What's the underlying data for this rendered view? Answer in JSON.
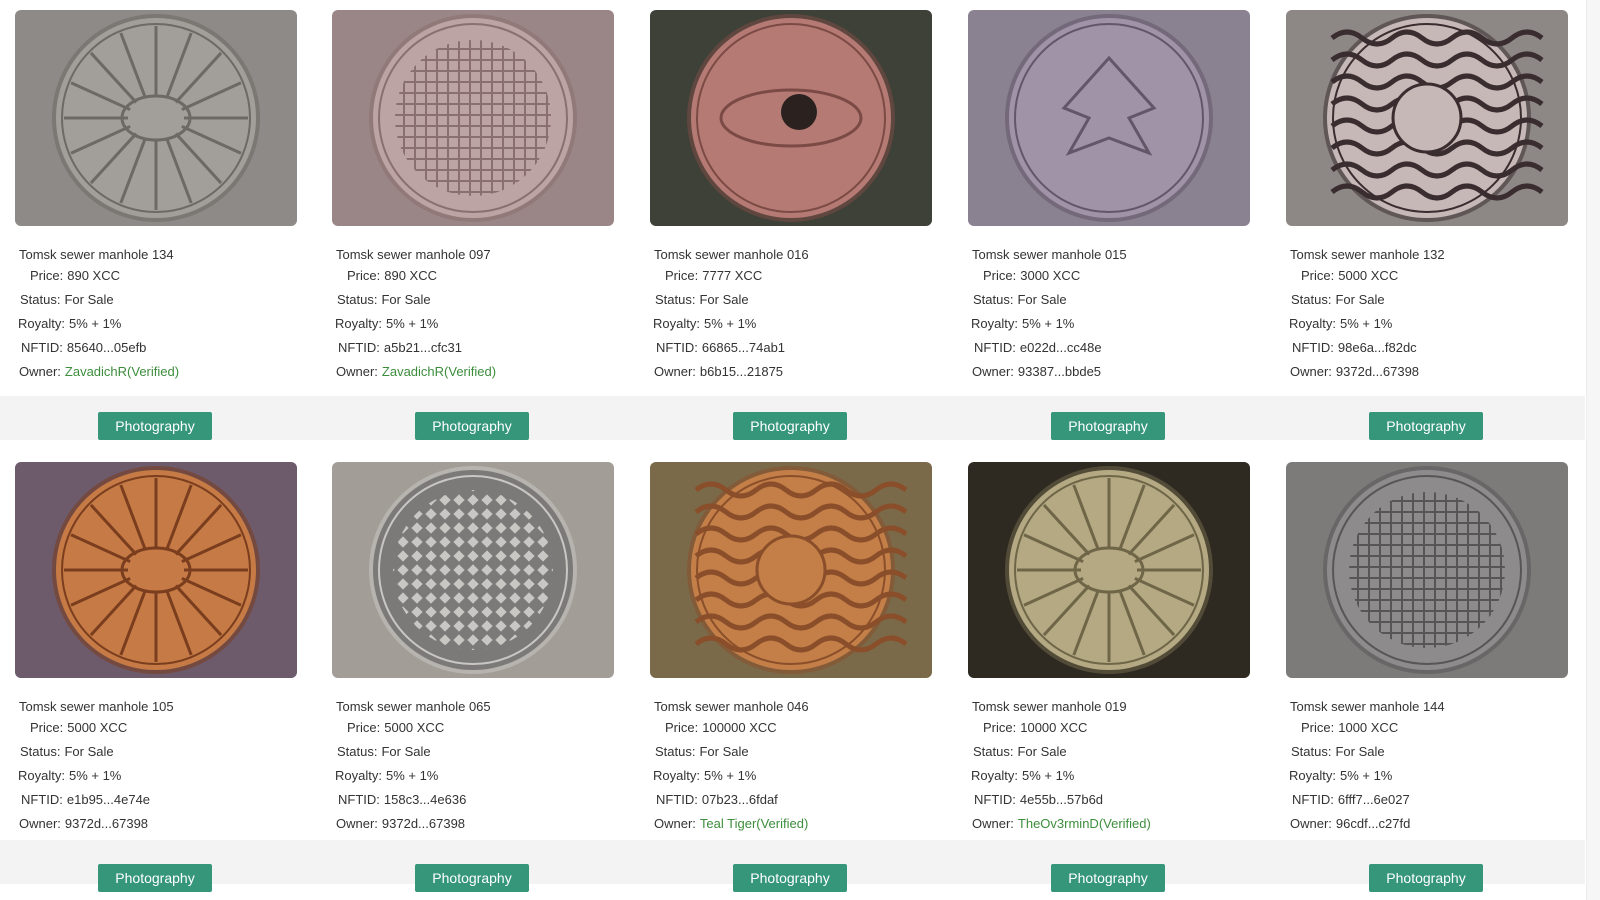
{
  "labels": {
    "price": "Price:",
    "status": "Status:",
    "royalty": "Royalty:",
    "nftid": "NFTID:",
    "owner": "Owner:"
  },
  "colors": {
    "tag_bg": "#35967a",
    "verified_owner": "#3c8d3c"
  },
  "items": [
    {
      "name": "Tomsk sewer manhole 134",
      "price": "890 XCC",
      "status": "For Sale",
      "royalty": "5% + 1%",
      "nftid": "85640...05efb",
      "owner": "ZavadichR(Verified)",
      "owner_verified": true,
      "tag": "Photography",
      "image": "spoked-manhole-grey"
    },
    {
      "name": "Tomsk sewer manhole 097",
      "price": "890 XCC",
      "status": "For Sale",
      "royalty": "5% + 1%",
      "nftid": "a5b21...cfc31",
      "owner": "ZavadichR(Verified)",
      "owner_verified": true,
      "tag": "Photography",
      "image": "grid-manhole-pink"
    },
    {
      "name": "Tomsk sewer manhole 016",
      "price": "7777 XCC",
      "status": "For Sale",
      "royalty": "5% + 1%",
      "nftid": "66865...74ab1",
      "owner": "b6b15...21875",
      "owner_verified": false,
      "tag": "Photography",
      "image": "eye-manhole-red"
    },
    {
      "name": "Tomsk sewer manhole 015",
      "price": "3000 XCC",
      "status": "For Sale",
      "royalty": "5% + 1%",
      "nftid": "e022d...cc48e",
      "owner": "93387...bbde5",
      "owner_verified": false,
      "tag": "Photography",
      "image": "leaf-manhole-purple"
    },
    {
      "name": "Tomsk sewer manhole 132",
      "price": "5000 XCC",
      "status": "For Sale",
      "royalty": "5% + 1%",
      "nftid": "98e6a...f82dc",
      "owner": "9372d...67398",
      "owner_verified": false,
      "tag": "Photography",
      "image": "wave-manhole-ks"
    },
    {
      "name": "Tomsk sewer manhole 105",
      "price": "5000 XCC",
      "status": "For Sale",
      "royalty": "5% + 1%",
      "nftid": "e1b95...4e74e",
      "owner": "9372d...67398",
      "owner_verified": false,
      "tag": "Photography",
      "image": "spoked-manhole-rust"
    },
    {
      "name": "Tomsk sewer manhole 065",
      "price": "5000 XCC",
      "status": "For Sale",
      "royalty": "5% + 1%",
      "nftid": "158c3...4e636",
      "owner": "9372d...67398",
      "owner_verified": false,
      "tag": "Photography",
      "image": "diamond-manhole-grey"
    },
    {
      "name": "Tomsk sewer manhole 046",
      "price": "100000 XCC",
      "status": "For Sale",
      "royalty": "5% + 1%",
      "nftid": "07b23...6fdaf",
      "owner": "Teal Tiger(Verified)",
      "owner_verified": true,
      "tag": "Photography",
      "image": "wave-manhole-b"
    },
    {
      "name": "Tomsk sewer manhole 019",
      "price": "10000 XCC",
      "status": "For Sale",
      "royalty": "5% + 1%",
      "nftid": "4e55b...57b6d",
      "owner": "TheOv3rminD(Verified)",
      "owner_verified": true,
      "tag": "Photography",
      "image": "spoked-manhole-tan"
    },
    {
      "name": "Tomsk sewer manhole 144",
      "price": "1000 XCC",
      "status": "For Sale",
      "royalty": "5% + 1%",
      "nftid": "6fff7...6e027",
      "owner": "96cdf...c27fd",
      "owner_verified": false,
      "tag": "Photography",
      "image": "grid-manhole-slate"
    }
  ]
}
